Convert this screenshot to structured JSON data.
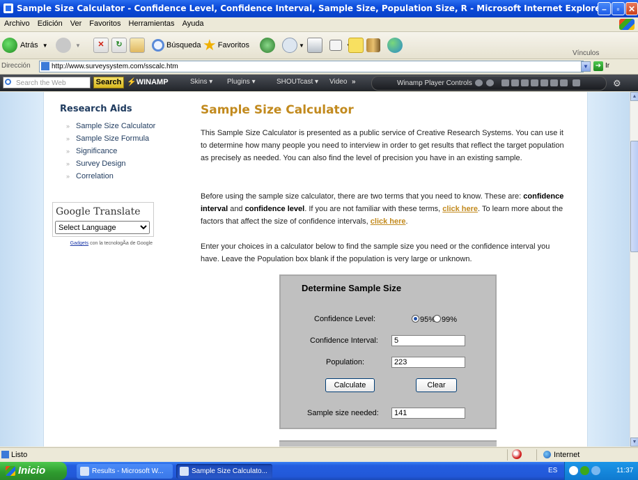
{
  "window": {
    "title": "Sample Size Calculator - Confidence Level, Confidence Interval, Sample Size, Population Size, R - Microsoft Internet Explorer"
  },
  "menu": [
    "Archivo",
    "Edición",
    "Ver",
    "Favoritos",
    "Herramientas",
    "Ayuda"
  ],
  "toolbar": {
    "back": "Atrás",
    "search": "Búsqueda",
    "favorites": "Favoritos"
  },
  "address": {
    "label": "Dirección",
    "url": "http://www.surveysystem.com/sscalc.htm",
    "go": "Ir",
    "links": "Vínculos"
  },
  "winamp": {
    "search_placeholder": "Search the Web",
    "search_button": "Search",
    "brand": "WINAMP",
    "skins": "Skins ▾",
    "plugins": "Plugins ▾",
    "shoutcast": "SHOUTcast ▾",
    "video": "Video",
    "player": "Winamp Player Controls"
  },
  "sidebar": {
    "heading": "Research Aids",
    "items": [
      "Sample Size Calculator",
      "Sample Size Formula",
      "Significance",
      "Survey Design",
      "Correlation"
    ],
    "translate_title": "Google Translate",
    "select_language": "Select Language",
    "gadgets_link": "Gadgets",
    "gadgets_text": "con la tecnologÃa de Google"
  },
  "main": {
    "title": "Sample Size Calculator",
    "intro": "This Sample Size Calculator is presented as a public service of Creative Research Systems. You can use it to determine how many people you need to interview in order to get results that reflect the target population as precisely as needed. You can also find the level of precision you have in an existing sample.",
    "p2_a": "Before using the sample size calculator, there are two terms that you need to know. These are: ",
    "p2_b1": "confidence interval",
    "p2_and": " and ",
    "p2_b2": "confidence level",
    "p2_c": ". If you are not familiar with these terms, ",
    "p2_link1": "click here",
    "p2_d": ". To learn more about the factors that affect the size of confidence intervals, ",
    "p2_link2": "click here",
    "p2_e": ".",
    "p3": "Enter your choices in a calculator below to find the sample size you need or the confidence interval you have. Leave the Population box blank if the population is very large or unknown."
  },
  "calculator": {
    "heading": "Determine Sample Size",
    "confidence_level_label": "Confidence Level:",
    "opt95": "95%",
    "opt99": "99%",
    "selected": "95%",
    "interval_label": "Confidence Interval:",
    "interval_value": "5",
    "population_label": "Population:",
    "population_value": "223",
    "calculate": "Calculate",
    "clear": "Clear",
    "result_label": "Sample size needed:",
    "result_value": "141"
  },
  "status": {
    "text": "Listo",
    "zone": "Internet"
  },
  "taskbar": {
    "start": "Inicio",
    "task1": "Results - Microsoft W...",
    "task2": "Sample Size Calculato...",
    "lang": "ES",
    "clock": "11:37"
  },
  "colors": {
    "title_accent": "#c28a1e",
    "link": "#c28a1e",
    "sidebar_heading": "#1e3a5e",
    "calc_bg": "#c0c0c0",
    "titlebar": "#0a48d8"
  }
}
